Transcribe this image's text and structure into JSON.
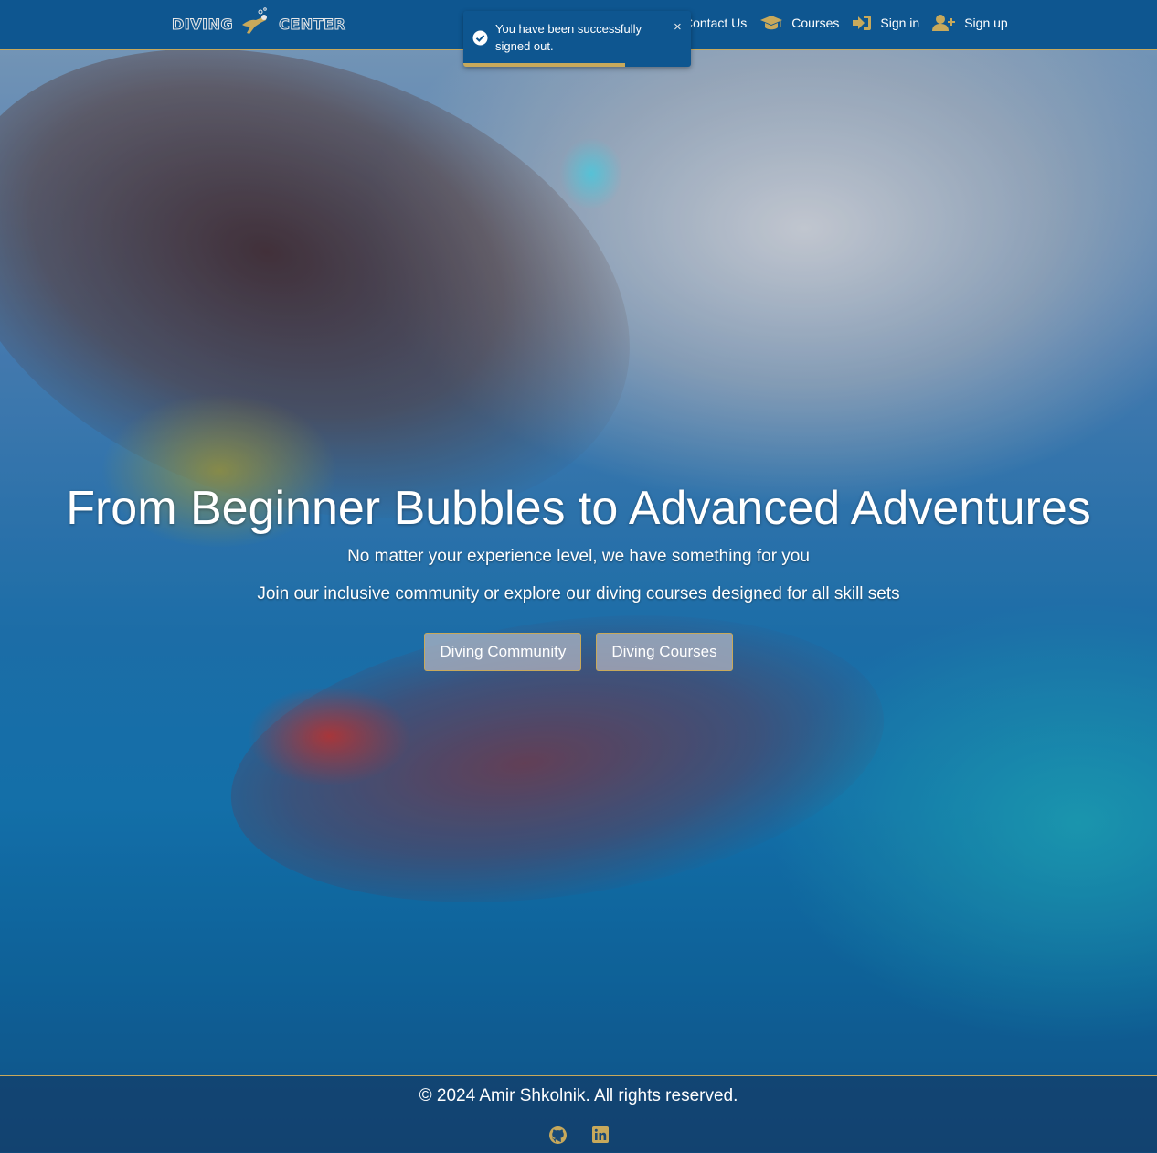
{
  "brand": {
    "logo_left": "DIVING",
    "logo_right": "CENTER",
    "accent_color": "#c8a95b",
    "navbar_color": "#0e5690"
  },
  "navbar": {
    "items": [
      {
        "label": "Contact Us",
        "icon": "envelope-icon"
      },
      {
        "label": "Courses",
        "icon": "graduation-cap-icon"
      },
      {
        "label": "Sign in",
        "icon": "sign-in-icon"
      },
      {
        "label": "Sign up",
        "icon": "user-plus-icon"
      }
    ]
  },
  "toast": {
    "message": "You have been successfully signed out.",
    "icon": "check-circle-icon",
    "close_label": "×",
    "progress": 0.71
  },
  "hero": {
    "title": "From Beginner Bubbles to Advanced Adventures",
    "subtitle": "No matter your experience level, we have something for you",
    "subtitle2": "Join our inclusive community or explore our diving courses designed for all skill sets",
    "buttons": {
      "community": "Diving Community",
      "courses": "Diving Courses"
    }
  },
  "footer": {
    "copyright": "© 2024 Amir Shkolnik. All rights reserved.",
    "socials": [
      "github-icon",
      "linkedin-icon"
    ]
  }
}
